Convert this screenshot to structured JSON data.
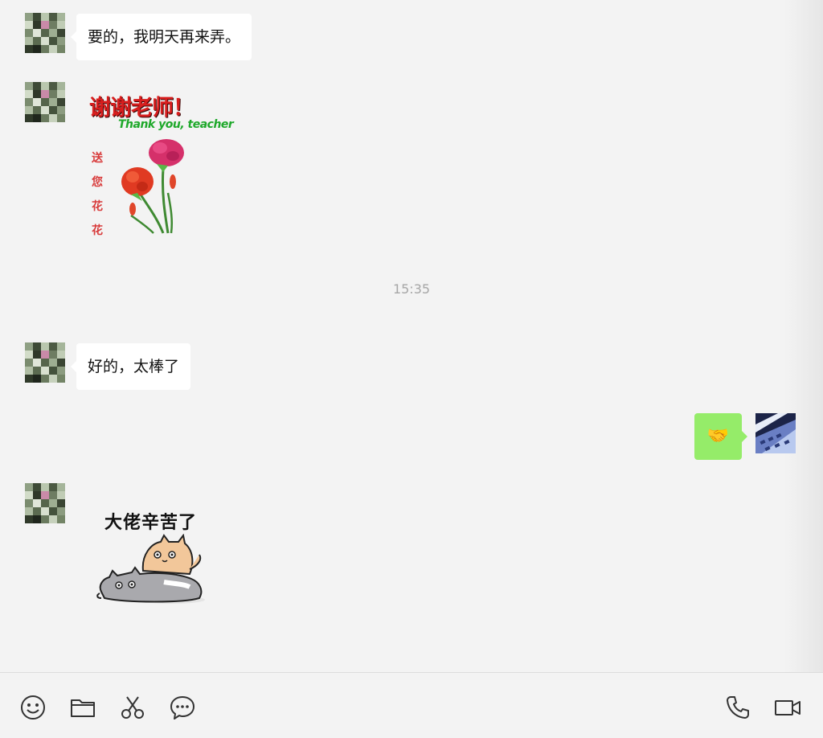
{
  "messages": [
    {
      "side": "left",
      "type": "text",
      "text": "要的，我明天再来弄。"
    },
    {
      "side": "left",
      "type": "sticker",
      "sticker": {
        "title": "谢谢老师！",
        "subtitle": "Thank you, teacher",
        "side_text": [
          "送",
          "您",
          "花",
          "花"
        ]
      }
    },
    {
      "type": "timestamp",
      "text": "15:35"
    },
    {
      "side": "left",
      "type": "text",
      "text": "好的，太棒了"
    },
    {
      "side": "right",
      "type": "emoji",
      "emoji": "🤝"
    },
    {
      "side": "left",
      "type": "sticker",
      "sticker": {
        "title": "大佬辛苦了"
      }
    }
  ],
  "toolbar": {
    "left": [
      "emoji-icon",
      "folder-icon",
      "scissors-icon",
      "chat-bubble-icon"
    ],
    "right": [
      "phone-icon",
      "video-call-icon"
    ]
  },
  "colors": {
    "background": "#f3f3f3",
    "incoming_bubble": "#ffffff",
    "outgoing_bubble": "#95ec69",
    "timestamp": "#a6a6a6"
  }
}
